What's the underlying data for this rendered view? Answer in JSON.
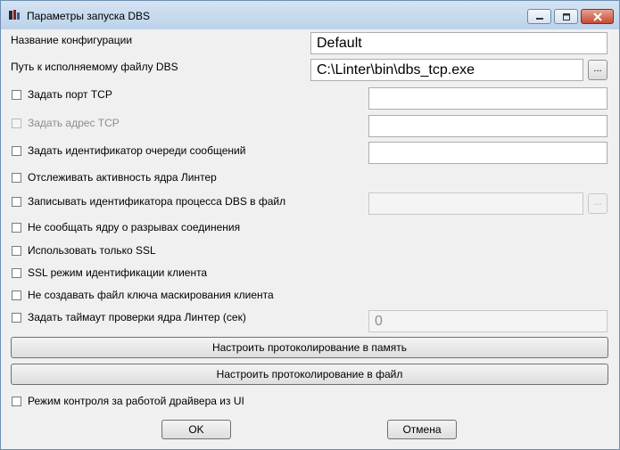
{
  "window": {
    "title": "Параметры запуска DBS",
    "icons": {
      "app": "dbs-app-icon",
      "minimize": "minimize-icon",
      "maximize": "maximize-icon",
      "close": "close-icon"
    }
  },
  "fields": {
    "config_name_label": "Название конфигурации",
    "config_name_value": "Default",
    "exe_path_label": "Путь к исполняемому файлу DBS",
    "exe_path_value": "C:\\Linter\\bin\\dbs_tcp.exe",
    "browse_label": "...",
    "browse_pid_label": "..."
  },
  "options": {
    "tcp_port": "Задать порт TCP",
    "tcp_address": "Задать адрес TCP",
    "queue_id": "Задать идентификатор очереди сообщений",
    "track_activity": "Отслеживать активность ядра Линтер",
    "write_pid": "Записывать идентификатора процесса DBS в файл",
    "no_disconnect": "Не сообщать ядру о разрывах соединения",
    "ssl_only": "Использовать только SSL",
    "ssl_client_auth": "SSL режим идентификации клиента",
    "no_mask_key": "Не создавать файл ключа маскирования клиента",
    "kernel_timeout": "Задать таймаут проверки ядра Линтер (сек)",
    "kernel_timeout_value": "0",
    "driver_ui_mode": "Режим контроля за работой драйвера из UI"
  },
  "buttons": {
    "log_memory": "Настроить протоколирование в память",
    "log_file": "Настроить протоколирование в файл",
    "ok": "OK",
    "cancel": "Отмена"
  }
}
